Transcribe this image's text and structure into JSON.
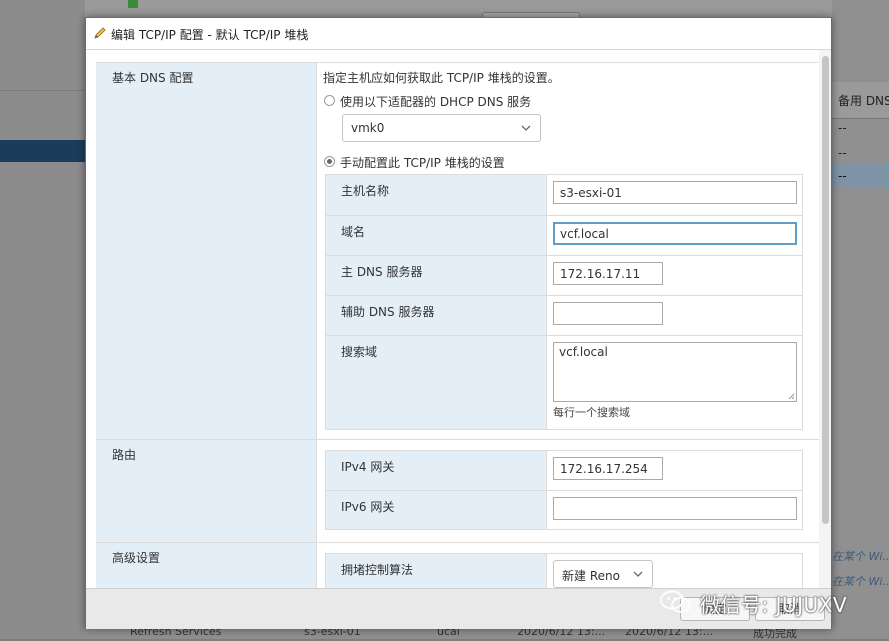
{
  "background": {
    "column_header": "备用 DNS",
    "cells": [
      "--",
      "--",
      "--"
    ],
    "side_links": [
      "在某个 Wi...",
      "在某个 Wi..."
    ],
    "bottom_row": [
      "Refresh Services",
      "s3-esxi-01",
      "ucal",
      "2020/6/12 13:...",
      "2020/6/12 13:..."
    ],
    "status_text": "成功完成"
  },
  "dialog": {
    "title": "编辑 TCP/IP 配置 - 默认 TCP/IP 堆栈",
    "dns_section": {
      "label": "基本 DNS 配置",
      "instruction": "指定主机应如何获取此 TCP/IP 堆栈的设置。",
      "option_dhcp": "使用以下适配器的 DHCP DNS 服务",
      "option_dhcp_selected": false,
      "adapter_value": "vmk0",
      "option_manual": "手动配置此 TCP/IP 堆栈的设置",
      "option_manual_selected": true,
      "fields": {
        "host_name_label": "主机名称",
        "host_name_value": "s3-esxi-01",
        "domain_label": "域名",
        "domain_value": "vcf.local",
        "primary_dns_label": "主 DNS 服务器",
        "primary_dns_value": "172.16.17.11",
        "secondary_dns_label": "辅助 DNS 服务器",
        "secondary_dns_value": "",
        "search_domains_label": "搜索域",
        "search_domains_value": "vcf.local",
        "search_domains_hint": "每行一个搜索域"
      }
    },
    "routing_section": {
      "label": "路由",
      "ipv4_gateway_label": "IPv4 网关",
      "ipv4_gateway_value": "172.16.17.254",
      "ipv6_gateway_label": "IPv6 网关",
      "ipv6_gateway_value": ""
    },
    "advanced_section": {
      "label": "高级设置",
      "congestion_label": "拥堵控制算法",
      "congestion_value": "新建 Reno"
    },
    "footer": {
      "ok_label": "确定",
      "cancel_label": "取消"
    }
  },
  "watermark": {
    "text": "微信号: JUJUXV"
  }
}
